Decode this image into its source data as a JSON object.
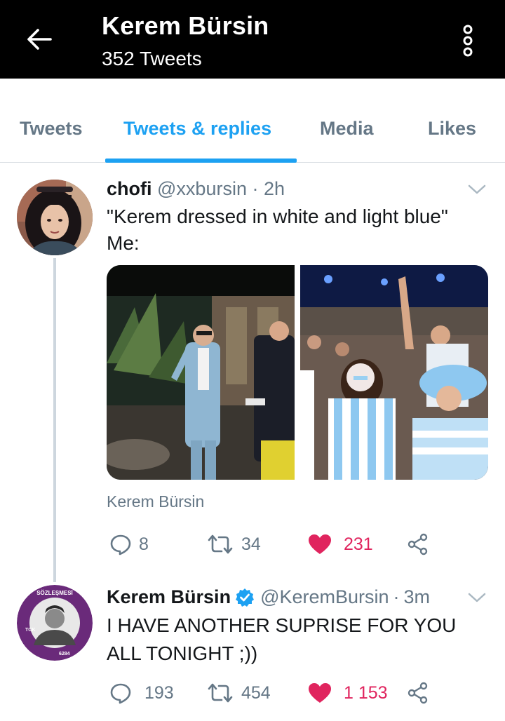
{
  "header": {
    "title": "Kerem Bürsin",
    "subtitle": "352 Tweets",
    "back_icon": "arrow-left-icon",
    "more_icon": "more-vertical-icon"
  },
  "tabs": [
    {
      "label": "Tweets",
      "active": false
    },
    {
      "label": "Tweets & replies",
      "active": true
    },
    {
      "label": "Media",
      "active": false
    },
    {
      "label": "Likes",
      "active": false
    }
  ],
  "colors": {
    "accent": "#1da1f2",
    "like": "#e0245e",
    "muted": "#657786",
    "header_bg": "#000000"
  },
  "tweets": [
    {
      "name": "chofi",
      "handle": "@xxbursin",
      "separator": "·",
      "time": "2h",
      "text_line1": "\"Kerem dressed in white and light blue\"",
      "text_line2": "Me:",
      "caption": "Kerem Bürsin",
      "replies": "8",
      "retweets": "34",
      "likes": "231",
      "liked": true
    },
    {
      "name": "Kerem Bürsin",
      "verified": true,
      "handle": "@KeremBursin",
      "separator": "·",
      "time": "3m",
      "text_line1": "I HAVE ANOTHER SUPRISE FOR YOU",
      "text_line2": "ALL TONIGHT ;))",
      "replies": "193",
      "retweets": "454",
      "likes": "1 153",
      "liked": true,
      "avatar_badge_text": "İSTANBUL SÖZLEŞMESİ YAŞATIR"
    }
  ]
}
